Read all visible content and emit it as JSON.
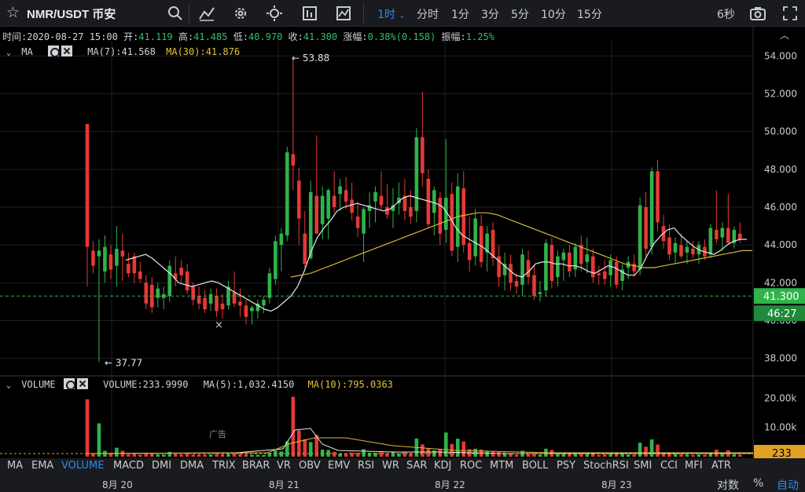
{
  "toolbar": {
    "symbol": "NMR/USDT 币安",
    "timeframes": [
      "1时",
      "分时",
      "1分",
      "3分",
      "5分",
      "10分",
      "15分"
    ],
    "active_timeframe": "1时",
    "right_label": "6秒"
  },
  "info": {
    "time_label": "时间:",
    "time": "2020-08-27 15:00",
    "open_label": "开:",
    "open": "41.119",
    "high_label": "高:",
    "high": "41.485",
    "low_label": "低:",
    "low": "40.970",
    "close_label": "收:",
    "close": "41.300",
    "change_label": "涨幅:",
    "change": "0.38%(0.158)",
    "amp_label": "振幅:",
    "amp": "1.25%"
  },
  "ma_panel": {
    "name": "MA",
    "ma7": "MA(7):41.568",
    "ma30": "MA(30):41.876"
  },
  "vol_panel": {
    "name": "VOLUME",
    "vol": "VOLUME:233.9990",
    "ma5": "MA(5):1,032.4150",
    "ma10": "MA(10):795.0363"
  },
  "ad_label": "广告",
  "chart_data": {
    "type": "candlestick",
    "y_ticks": [
      "54.000",
      "52.000",
      "50.000",
      "48.000",
      "46.000",
      "44.000",
      "42.000",
      "40.000",
      "38.000"
    ],
    "ylim": [
      37.2,
      54.8
    ],
    "high_annotation": "53.88",
    "low_annotation": "37.77",
    "last_price": "41.300",
    "countdown": "46:27",
    "vol_ticks": [
      "20.00k",
      "10.00k"
    ],
    "vol_ylim": [
      0,
      22000
    ],
    "last_volume": "233",
    "x_labels": [
      "8月 20",
      "8月 21",
      "8月 22",
      "8月 23"
    ],
    "candles": [
      [
        50.4,
        50.4,
        41.8,
        43.9
      ],
      [
        43.7,
        44.2,
        42.5,
        42.9
      ],
      [
        43.4,
        44.3,
        37.8,
        43.7
      ],
      [
        42.6,
        44.5,
        42.0,
        43.9
      ],
      [
        43.5,
        44.0,
        42.2,
        42.7
      ],
      [
        42.9,
        45.0,
        41.8,
        43.8
      ],
      [
        43.7,
        44.6,
        42.1,
        43.4
      ],
      [
        43.0,
        43.6,
        42.3,
        42.5
      ],
      [
        43.4,
        43.6,
        42.0,
        42.5
      ],
      [
        42.6,
        43.1,
        42.0,
        42.2
      ],
      [
        42.0,
        42.4,
        40.6,
        40.9
      ],
      [
        41.9,
        42.3,
        40.4,
        40.7
      ],
      [
        41.2,
        42.0,
        40.7,
        41.7
      ],
      [
        41.2,
        41.8,
        40.6,
        41.4
      ],
      [
        41.3,
        43.2,
        41.0,
        42.9
      ],
      [
        42.5,
        43.4,
        41.8,
        42.2
      ],
      [
        42.8,
        43.2,
        42.0,
        42.4
      ],
      [
        42.6,
        43.0,
        41.4,
        41.6
      ],
      [
        41.8,
        42.0,
        40.8,
        41.1
      ],
      [
        41.3,
        41.8,
        40.6,
        40.9
      ],
      [
        41.2,
        41.6,
        40.4,
        40.6
      ],
      [
        40.9,
        41.7,
        40.5,
        41.4
      ],
      [
        41.3,
        41.7,
        40.2,
        40.5
      ],
      [
        40.9,
        41.4,
        40.1,
        40.6
      ],
      [
        40.8,
        42.1,
        40.6,
        41.8
      ],
      [
        41.5,
        42.6,
        40.7,
        40.9
      ],
      [
        41.0,
        41.7,
        40.2,
        40.8
      ],
      [
        40.8,
        41.1,
        39.8,
        40.2
      ],
      [
        40.5,
        40.8,
        39.8,
        40.7
      ],
      [
        40.5,
        41.1,
        40.1,
        40.9
      ],
      [
        40.8,
        41.3,
        40.4,
        41.1
      ],
      [
        41.2,
        42.8,
        40.9,
        42.5
      ],
      [
        42.2,
        44.5,
        41.9,
        44.2
      ],
      [
        44.0,
        44.9,
        42.6,
        44.6
      ],
      [
        44.5,
        49.2,
        44.2,
        48.9
      ],
      [
        48.8,
        53.9,
        46.9,
        48.2
      ],
      [
        47.4,
        48.1,
        44.0,
        45.4
      ],
      [
        44.6,
        45.8,
        42.8,
        43.0
      ],
      [
        43.3,
        47.4,
        43.2,
        46.8
      ],
      [
        46.6,
        49.8,
        44.6,
        44.6
      ],
      [
        45.1,
        47.1,
        44.3,
        46.6
      ],
      [
        45.4,
        47.0,
        44.3,
        46.9
      ],
      [
        46.6,
        47.9,
        45.7,
        46.0
      ],
      [
        46.7,
        47.5,
        45.8,
        47.1
      ],
      [
        46.9,
        47.6,
        45.9,
        46.3
      ],
      [
        46.4,
        47.3,
        45.3,
        45.7
      ],
      [
        45.5,
        46.3,
        44.4,
        44.9
      ],
      [
        44.6,
        46.0,
        43.1,
        45.9
      ],
      [
        45.8,
        46.8,
        44.9,
        46.1
      ],
      [
        46.3,
        47.1,
        45.2,
        46.8
      ],
      [
        46.6,
        47.9,
        45.8,
        46.1
      ],
      [
        46.0,
        47.2,
        45.4,
        45.6
      ],
      [
        45.8,
        47.0,
        44.9,
        46.1
      ],
      [
        46.2,
        47.3,
        45.6,
        46.5
      ],
      [
        46.6,
        47.5,
        45.3,
        45.8
      ],
      [
        46.0,
        46.9,
        45.1,
        45.5
      ],
      [
        45.8,
        50.2,
        45.2,
        49.7
      ],
      [
        49.7,
        52.1,
        47.1,
        47.8
      ],
      [
        47.5,
        48.0,
        44.9,
        45.1
      ],
      [
        45.7,
        47.1,
        44.5,
        46.9
      ],
      [
        46.5,
        46.8,
        44.0,
        44.6
      ],
      [
        44.8,
        49.6,
        44.1,
        46.5
      ],
      [
        46.7,
        47.3,
        43.4,
        43.7
      ],
      [
        43.9,
        47.8,
        43.1,
        47.1
      ],
      [
        47.0,
        47.9,
        43.6,
        44.0
      ],
      [
        44.1,
        45.5,
        42.6,
        43.2
      ],
      [
        43.4,
        45.9,
        42.9,
        45.4
      ],
      [
        45.0,
        45.6,
        42.8,
        43.1
      ],
      [
        43.6,
        45.0,
        42.6,
        44.6
      ],
      [
        44.8,
        45.2,
        42.9,
        43.3
      ],
      [
        43.4,
        44.0,
        41.8,
        42.3
      ],
      [
        42.4,
        43.6,
        41.6,
        43.0
      ],
      [
        43.0,
        43.5,
        41.6,
        42.0
      ],
      [
        42.1,
        42.5,
        41.4,
        41.8
      ],
      [
        41.9,
        43.8,
        41.3,
        43.5
      ],
      [
        43.2,
        43.7,
        41.9,
        42.3
      ],
      [
        42.4,
        42.9,
        41.1,
        41.3
      ],
      [
        41.4,
        42.1,
        41.0,
        41.5
      ],
      [
        41.6,
        44.3,
        41.3,
        44.1
      ],
      [
        44.0,
        44.4,
        41.7,
        42.1
      ],
      [
        42.3,
        43.7,
        41.8,
        43.4
      ],
      [
        43.2,
        43.8,
        42.1,
        43.6
      ],
      [
        43.6,
        44.0,
        42.3,
        42.6
      ],
      [
        42.7,
        44.1,
        42.3,
        43.9
      ],
      [
        44.0,
        44.5,
        42.6,
        43.0
      ],
      [
        43.1,
        44.4,
        42.5,
        43.5
      ],
      [
        43.4,
        43.8,
        42.0,
        42.3
      ],
      [
        42.5,
        42.9,
        41.9,
        42.4
      ],
      [
        42.6,
        43.2,
        41.9,
        42.2
      ],
      [
        42.4,
        43.5,
        41.8,
        43.2
      ],
      [
        43.1,
        43.4,
        41.7,
        41.9
      ],
      [
        42.1,
        43.0,
        41.6,
        42.7
      ],
      [
        42.8,
        43.4,
        42.2,
        43.1
      ],
      [
        43.0,
        43.5,
        42.3,
        42.6
      ],
      [
        42.7,
        46.5,
        42.4,
        46.1
      ],
      [
        46.0,
        46.8,
        43.4,
        43.8
      ],
      [
        43.9,
        48.1,
        43.5,
        47.9
      ],
      [
        47.9,
        48.5,
        44.7,
        45.2
      ],
      [
        45.0,
        45.6,
        43.8,
        44.2
      ],
      [
        44.4,
        45.1,
        43.2,
        43.5
      ],
      [
        43.6,
        44.4,
        43.0,
        44.1
      ],
      [
        44.0,
        44.6,
        43.3,
        43.4
      ],
      [
        43.6,
        44.2,
        43.0,
        43.9
      ],
      [
        43.8,
        44.2,
        43.3,
        43.5
      ],
      [
        43.5,
        44.2,
        43.0,
        44.0
      ],
      [
        43.9,
        44.3,
        43.2,
        43.4
      ],
      [
        43.5,
        45.1,
        43.3,
        44.9
      ],
      [
        44.8,
        46.9,
        44.1,
        44.3
      ],
      [
        44.4,
        45.2,
        43.7,
        44.9
      ],
      [
        44.9,
        46.7,
        44.1,
        44.1
      ],
      [
        44.1,
        45.0,
        43.8,
        44.8
      ],
      [
        44.6,
        45.2,
        44.1,
        44.3
      ]
    ],
    "ma_short": [
      43.2,
      43.3,
      43.4,
      43.5,
      43.3,
      43.0,
      42.7,
      42.4,
      42.0,
      41.9,
      41.8,
      41.9,
      42.0,
      42.1,
      42.0,
      41.8,
      41.6,
      41.4,
      41.2,
      41.0,
      40.8,
      40.6,
      40.5,
      40.7,
      41.0,
      41.3,
      41.8,
      42.6,
      43.6,
      44.4,
      44.9,
      45.3,
      45.8,
      46.0,
      46.1,
      46.2,
      46.1,
      46.0,
      45.9,
      45.8,
      45.9,
      46.2,
      46.5,
      46.6,
      46.5,
      46.4,
      46.3,
      46.2,
      46.0,
      45.5,
      44.9,
      44.5,
      44.3,
      44.1,
      43.9,
      43.6,
      43.3,
      43.0,
      42.7,
      42.4,
      42.3,
      42.6,
      43.0,
      43.1,
      43.1,
      43.0,
      43.0,
      42.9,
      42.9,
      42.8,
      42.6,
      42.5,
      42.7,
      42.9,
      42.8,
      42.6,
      42.4,
      42.4,
      42.8,
      43.5,
      44.1,
      44.5,
      44.8,
      44.9,
      44.5,
      44.2,
      43.9,
      43.7,
      43.6,
      43.5,
      43.7,
      44.0,
      44.2,
      44.3,
      44.3
    ],
    "ma_long": [
      42.3,
      42.4,
      42.5,
      42.7,
      42.9,
      43.1,
      43.3,
      43.5,
      43.7,
      43.9,
      44.1,
      44.3,
      44.5,
      44.7,
      44.9,
      45.1,
      45.3,
      45.5,
      45.6,
      45.7,
      45.7,
      45.6,
      45.4,
      45.2,
      45.0,
      44.8,
      44.6,
      44.4,
      44.2,
      44.0,
      43.8,
      43.6,
      43.4,
      43.2,
      43.0,
      42.9,
      42.8,
      42.8,
      42.9,
      43.0,
      43.1,
      43.2,
      43.3,
      43.4,
      43.5,
      43.6,
      43.7,
      43.7
    ]
  },
  "indicators": [
    "MA",
    "EMA",
    "VOLUME",
    "MACD",
    "DMI",
    "DMA",
    "TRIX",
    "BRAR",
    "VR",
    "OBV",
    "EMV",
    "RSI",
    "WR",
    "SAR",
    "KDJ",
    "ROC",
    "MTM",
    "BOLL",
    "PSY",
    "StochRSI",
    "SMI",
    "CCI",
    "MFI",
    "ATR"
  ],
  "active_indicator": "VOLUME",
  "bottom_right": {
    "log": "对数",
    "pct": "%",
    "auto": "自动"
  }
}
